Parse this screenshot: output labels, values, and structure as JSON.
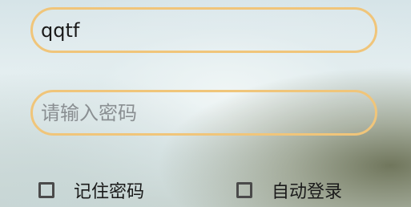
{
  "form": {
    "username": {
      "value": "qqtf",
      "placeholder": ""
    },
    "password": {
      "value": "",
      "placeholder": "请输入密码"
    },
    "remember_password": {
      "label": "记住密码",
      "checked": false
    },
    "auto_login": {
      "label": "自动登录",
      "checked": false
    }
  },
  "colors": {
    "field_border": "#f0c57a",
    "checkbox_border": "#4a4a4a",
    "text": "#1a1a1a",
    "placeholder": "#8a8f92"
  }
}
